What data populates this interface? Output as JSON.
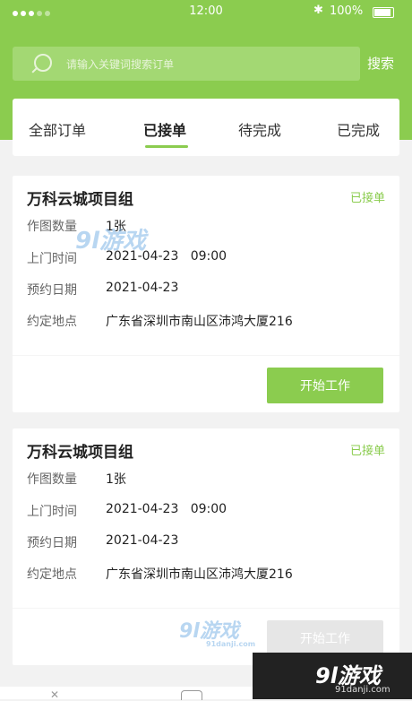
{
  "status_bar": {
    "time": "12:00",
    "battery": "100%",
    "bluetooth": "✱"
  },
  "search": {
    "placeholder": "请输入关键词搜索订单",
    "button": "搜索"
  },
  "tabs": [
    {
      "label": "全部订单"
    },
    {
      "label": "已接单"
    },
    {
      "label": "待完成"
    },
    {
      "label": "已完成"
    }
  ],
  "active_tab": 1,
  "orders": [
    {
      "title": "万科云城项目组",
      "status": "已接单",
      "fields": [
        {
          "label": "作图数量",
          "value": "1张"
        },
        {
          "label": "上门时间",
          "value": "2021-04-23   09:00"
        },
        {
          "label": "预约日期",
          "value": "2021-04-23"
        },
        {
          "label": "约定地点",
          "value": "广东省深圳市南山区沛鸿大厦216"
        }
      ],
      "button": "开始工作"
    },
    {
      "title": "万科云城项目组",
      "status": "已接单",
      "fields": [
        {
          "label": "作图数量",
          "value": "1张"
        },
        {
          "label": "上门时间",
          "value": "2021-04-23   09:00"
        },
        {
          "label": "预约日期",
          "value": "2021-04-23"
        },
        {
          "label": "约定地点",
          "value": "广东省深圳市南山区沛鸿大厦216"
        }
      ],
      "button": "开始工作"
    }
  ],
  "watermarks": {
    "logo_text": "9l游戏",
    "logo_url": "91danji.com"
  },
  "colors": {
    "accent": "#8bcc4f",
    "background": "#f2f2f2"
  }
}
